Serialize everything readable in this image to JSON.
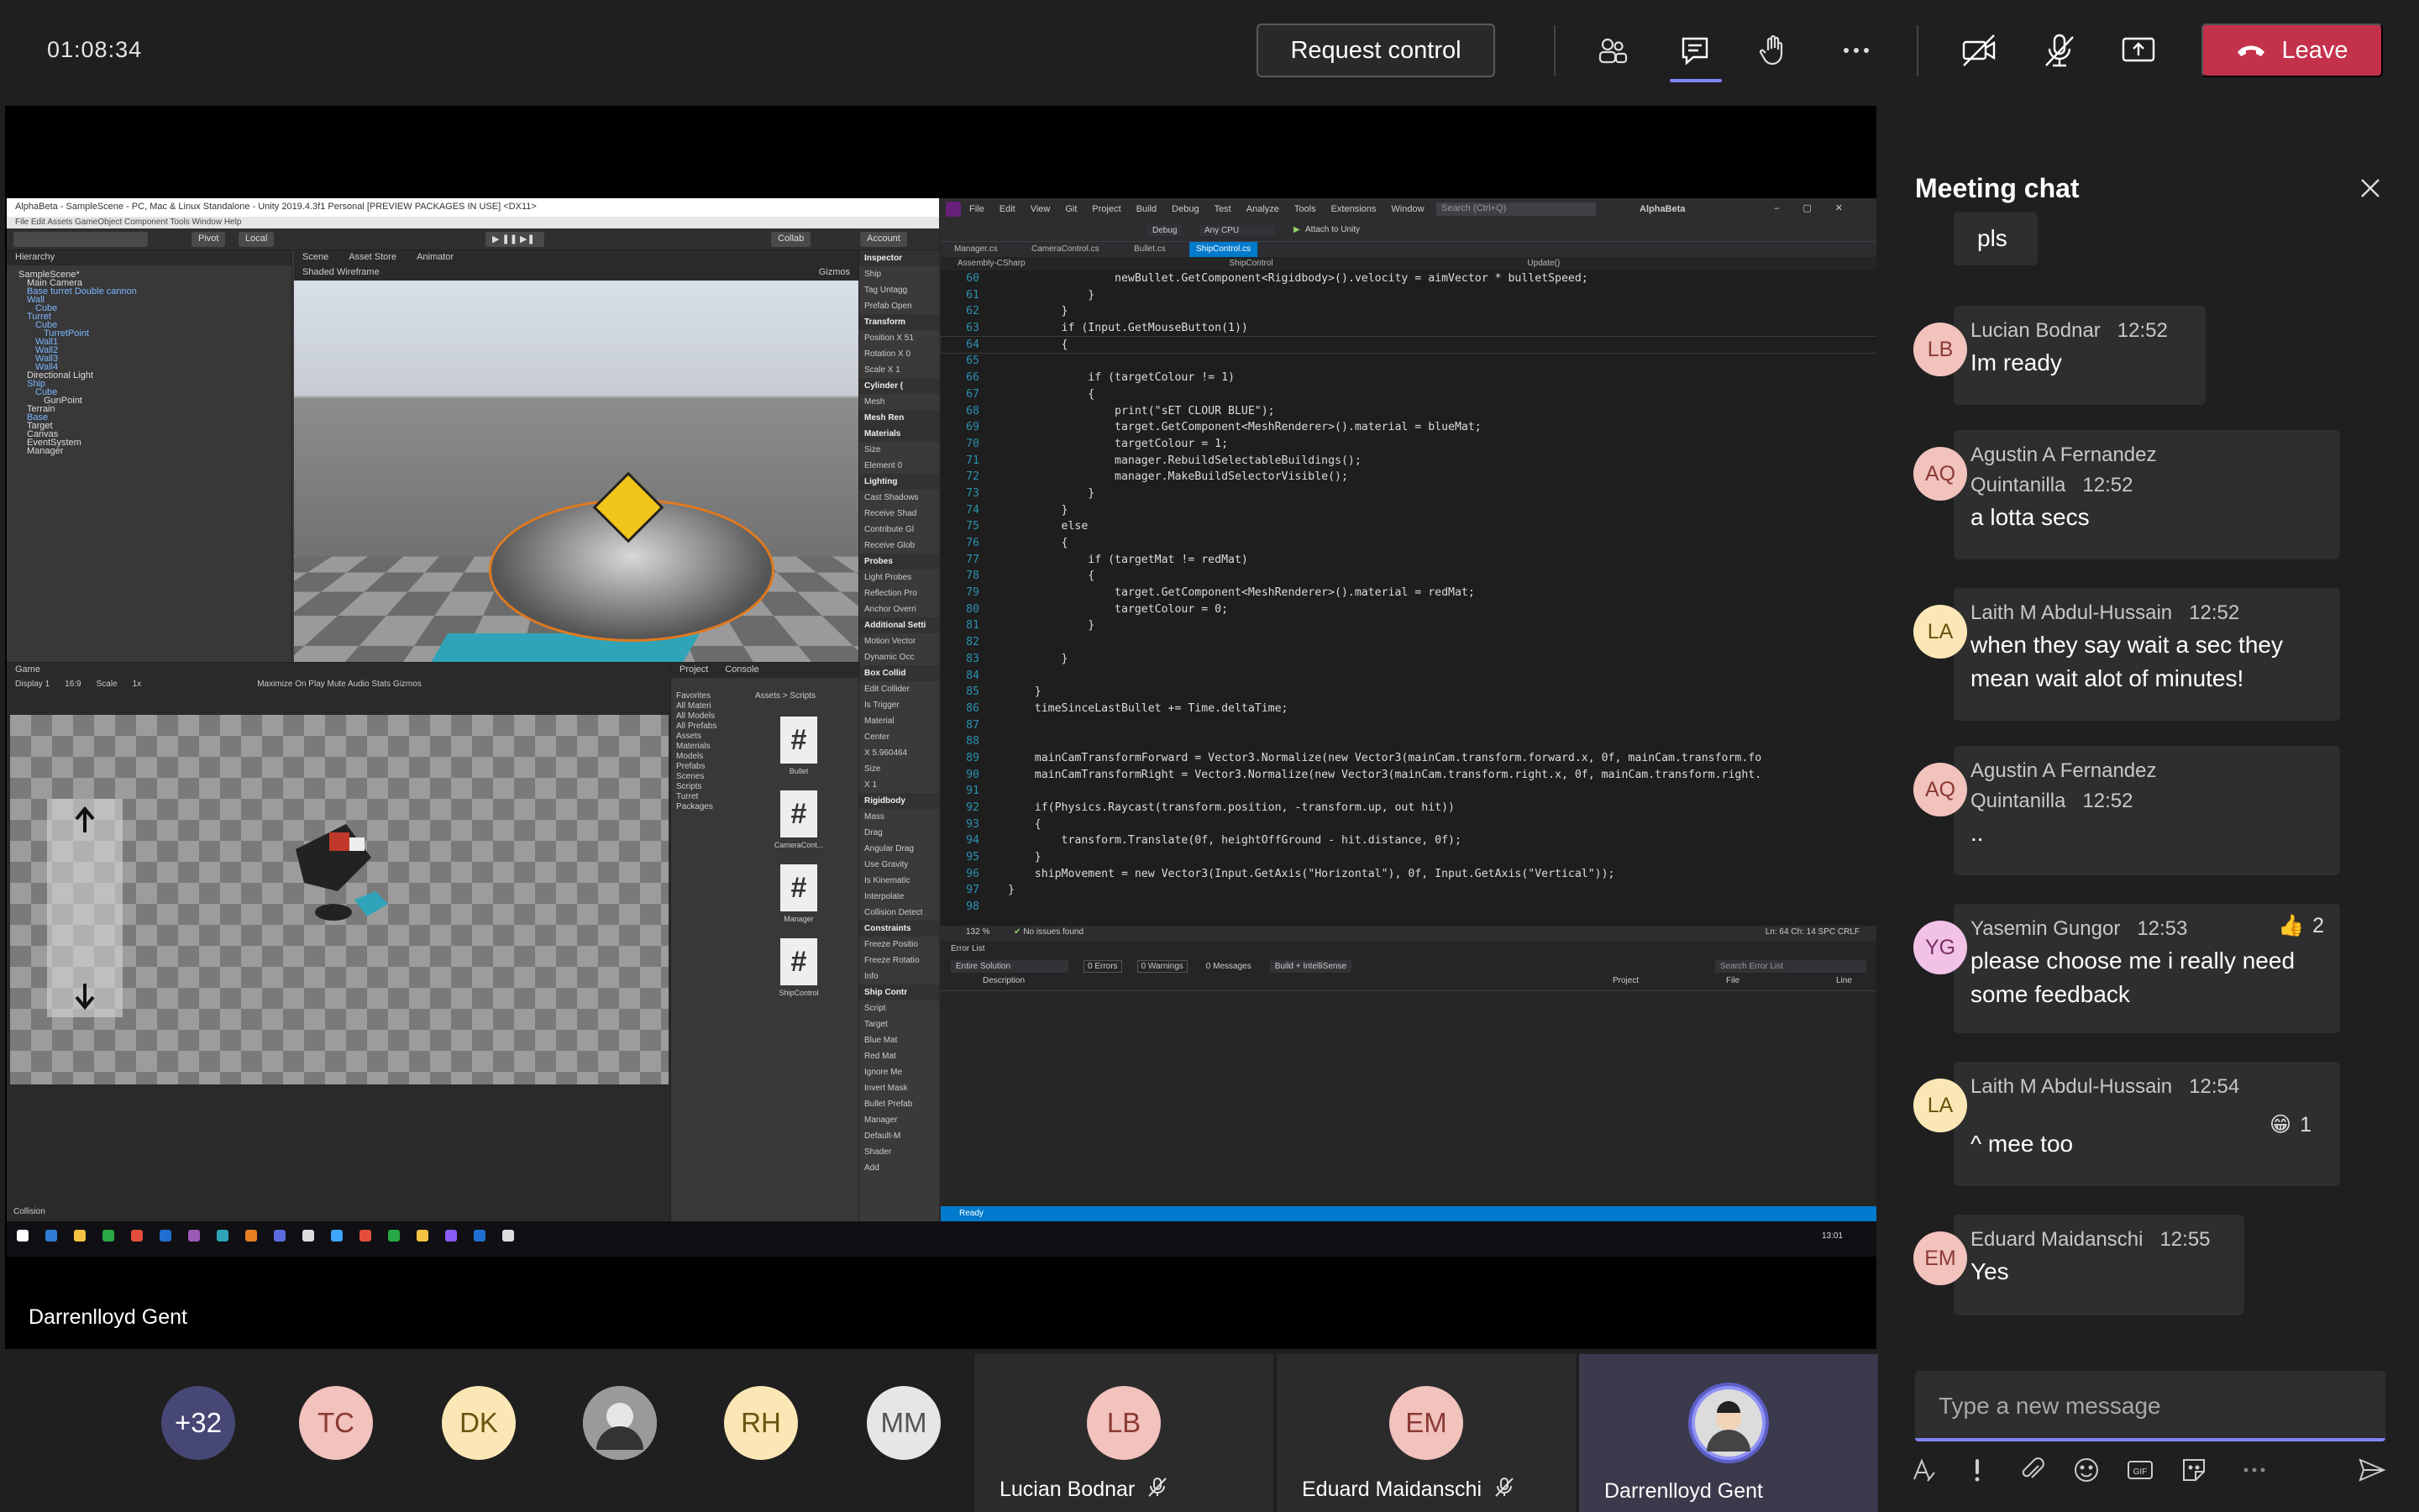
{
  "meeting": {
    "elapsed": "01:08:34",
    "request_control_label": "Request control",
    "leave_label": "Leave",
    "toolbar_icons": [
      "people-icon",
      "chat-icon",
      "raise-hand-icon",
      "more-options-icon",
      "camera-off-icon",
      "mic-off-icon",
      "share-screen-icon"
    ]
  },
  "stage": {
    "presenter_name": "Darrenlloyd Gent"
  },
  "unity": {
    "title": "AlphaBeta - SampleScene - PC, Mac & Linux Standalone - Unity 2019.4.3f1 Personal [PREVIEW PACKAGES IN USE] <DX11>",
    "menu": "File   Edit   Assets   GameObject   Component   Tools   Window   Help",
    "toolbar": {
      "pivot": "Pivot",
      "local": "Local",
      "collab": "Collab",
      "account": "Account",
      "layers": "La"
    },
    "hierarchy_tab": "Hierarchy",
    "hierarchy": [
      {
        "label": "SampleScene*",
        "blue": false,
        "indent": 0
      },
      {
        "label": "Main Camera",
        "blue": false,
        "indent": 1
      },
      {
        "label": "Base turret Double cannon",
        "blue": true,
        "indent": 1
      },
      {
        "label": "Wall",
        "blue": true,
        "indent": 1
      },
      {
        "label": "Cube",
        "blue": true,
        "indent": 2
      },
      {
        "label": "Turret",
        "blue": true,
        "indent": 1
      },
      {
        "label": "Cube",
        "blue": true,
        "indent": 2
      },
      {
        "label": "TurretPoint",
        "blue": true,
        "indent": 3
      },
      {
        "label": "Wall1",
        "blue": true,
        "indent": 2
      },
      {
        "label": "Wall2",
        "blue": true,
        "indent": 2
      },
      {
        "label": "Wall3",
        "blue": true,
        "indent": 2
      },
      {
        "label": "Wall4",
        "blue": true,
        "indent": 2
      },
      {
        "label": "Directional Light",
        "blue": false,
        "indent": 1
      },
      {
        "label": "Ship",
        "blue": true,
        "indent": 1
      },
      {
        "label": "Cube",
        "blue": true,
        "indent": 2
      },
      {
        "label": "GunPoint",
        "blue": false,
        "indent": 3
      },
      {
        "label": "Terrain",
        "blue": false,
        "indent": 1
      },
      {
        "label": "Base",
        "blue": true,
        "indent": 1
      },
      {
        "label": "Target",
        "blue": false,
        "indent": 1
      },
      {
        "label": "Canvas",
        "blue": false,
        "indent": 1
      },
      {
        "label": "EventSystem",
        "blue": false,
        "indent": 1
      },
      {
        "label": "Manager",
        "blue": false,
        "indent": 1
      }
    ],
    "scene_tabs": [
      "Scene",
      "Asset Store",
      "Animator"
    ],
    "scene_shading": "Shaded Wireframe",
    "gizmos_label": "Gizmos",
    "inspector": [
      "Inspector",
      "Ship",
      "Tag  Untagg",
      "Prefab  Open",
      "Transform",
      "Position  X 51",
      "Rotation  X 0",
      "Scale  X 1",
      "Cylinder (",
      "Mesh",
      "Mesh Ren",
      "Materials",
      "Size",
      "Element 0",
      "Lighting",
      "Cast Shadows",
      "Receive Shad",
      "Contribute Gl",
      "Receive Glob",
      "Probes",
      "Light Probes",
      "Reflection Pro",
      "Anchor Overri",
      "Additional Setti",
      "Motion Vector",
      "Dynamic Occ",
      "Box Collid",
      "Edit Collider",
      "Is Trigger",
      "Material",
      "Center",
      "X 5.960464",
      "Size",
      "X 1",
      "Rigidbody",
      "Mass",
      "Drag",
      "Angular Drag",
      "Use Gravity",
      "Is Kinematic",
      "Interpolate",
      "Collision Detect",
      "Constraints",
      "Freeze Positio",
      "Freeze Rotatio",
      "Info",
      "Ship Contr",
      "Script",
      "Target",
      "Blue Mat",
      "Red Mat",
      "Ignore Me",
      "Invert Mask",
      "Bullet Prefab",
      "Manager",
      "Default-M",
      "Shader",
      "Add"
    ],
    "game_tab": "Game",
    "game_bar": {
      "display": "Display 1",
      "aspect": "16:9",
      "scale_label": "Scale",
      "scale_value": "1x",
      "options": "Maximize On Play   Mute Audio   Stats   Gizmos"
    },
    "project_tabs": [
      "Project",
      "Console"
    ],
    "project_tree": [
      "Favorites",
      "All Materi",
      "All Models",
      "All Prefabs",
      "Assets",
      "Materials",
      "Models",
      "Prefabs",
      "Scenes",
      "Scripts",
      "Turret",
      "Packages"
    ],
    "breadcrumb": "Assets > Scripts",
    "scripts": [
      "Bullet",
      "CameraCont...",
      "Manager",
      "ShipControl"
    ],
    "status_text": "Collision"
  },
  "vs": {
    "menu": [
      "File",
      "Edit",
      "View",
      "Git",
      "Project",
      "Build",
      "Debug",
      "Test",
      "Analyze",
      "Tools",
      "Extensions",
      "Window",
      "Help"
    ],
    "search_placeholder": "Search (Ctrl+Q)",
    "solution": "AlphaBeta",
    "config": "Debug",
    "platform": "Any CPU",
    "attach_label": "Attach to Unity",
    "tabs": [
      "Manager.cs",
      "CameraControl.cs",
      "Bullet.cs",
      "ShipControl.cs"
    ],
    "nav": {
      "project": "Assembly-CSharp",
      "class": "ShipControl",
      "method": "Update()"
    },
    "code": [
      {
        "n": "60",
        "t": "                newBullet.GetComponent<Rigidbody>().velocity = aimVector * bulletSpeed;"
      },
      {
        "n": "61",
        "t": "            }"
      },
      {
        "n": "62",
        "t": "        }"
      },
      {
        "n": "63",
        "t": "        if (Input.GetMouseButton(1))"
      },
      {
        "n": "64",
        "t": "        {"
      },
      {
        "n": "65",
        "t": ""
      },
      {
        "n": "66",
        "t": "            if (targetColour != 1)"
      },
      {
        "n": "67",
        "t": "            {"
      },
      {
        "n": "68",
        "t": "                print(\"sET CLOUR BLUE\");"
      },
      {
        "n": "69",
        "t": "                target.GetComponent<MeshRenderer>().material = blueMat;"
      },
      {
        "n": "70",
        "t": "                targetColour = 1;"
      },
      {
        "n": "71",
        "t": "                manager.RebuildSelectableBuildings();"
      },
      {
        "n": "72",
        "t": "                manager.MakeBuildSelectorVisible();"
      },
      {
        "n": "73",
        "t": "            }"
      },
      {
        "n": "74",
        "t": "        }"
      },
      {
        "n": "75",
        "t": "        else"
      },
      {
        "n": "76",
        "t": "        {"
      },
      {
        "n": "77",
        "t": "            if (targetMat != redMat)"
      },
      {
        "n": "78",
        "t": "            {"
      },
      {
        "n": "79",
        "t": "                target.GetComponent<MeshRenderer>().material = redMat;"
      },
      {
        "n": "80",
        "t": "                targetColour = 0;"
      },
      {
        "n": "81",
        "t": "            }"
      },
      {
        "n": "82",
        "t": ""
      },
      {
        "n": "83",
        "t": "        }"
      },
      {
        "n": "84",
        "t": ""
      },
      {
        "n": "85",
        "t": "    }"
      },
      {
        "n": "86",
        "t": "    timeSinceLastBullet += Time.deltaTime;"
      },
      {
        "n": "87",
        "t": ""
      },
      {
        "n": "88",
        "t": ""
      },
      {
        "n": "89",
        "t": "    mainCamTransformForward = Vector3.Normalize(new Vector3(mainCam.transform.forward.x, 0f, mainCam.transform.fo"
      },
      {
        "n": "90",
        "t": "    mainCamTransformRight = Vector3.Normalize(new Vector3(mainCam.transform.right.x, 0f, mainCam.transform.right."
      },
      {
        "n": "91",
        "t": ""
      },
      {
        "n": "92",
        "t": "    if(Physics.Raycast(transform.position, -transform.up, out hit))"
      },
      {
        "n": "93",
        "t": "    {"
      },
      {
        "n": "94",
        "t": "        transform.Translate(0f, heightOffGround - hit.distance, 0f);"
      },
      {
        "n": "95",
        "t": "    }"
      },
      {
        "n": "96",
        "t": "    shipMovement = new Vector3(Input.GetAxis(\"Horizontal\"), 0f, Input.GetAxis(\"Vertical\"));"
      },
      {
        "n": "97",
        "t": "}"
      },
      {
        "n": "98",
        "t": ""
      }
    ],
    "status": {
      "zoom": "132 %",
      "issues": "No issues found",
      "position": "Ln: 64   Ch: 14   SPC   CRLF"
    },
    "error_list": {
      "title": "Error List",
      "scope": "Entire Solution",
      "errors": "0 Errors",
      "warnings": "0 Warnings",
      "messages": "0 Messages",
      "build": "Build + IntelliSense",
      "search": "Search Error List",
      "columns": [
        "Description",
        "Project",
        "File",
        "Line"
      ]
    },
    "ready": "Ready",
    "clock": "13:01"
  },
  "participants": {
    "overflow": "+32",
    "avatars": [
      {
        "initials": "TC",
        "bg": "#f2c2bd",
        "fg": "#8a3a33"
      },
      {
        "initials": "DK",
        "bg": "#fbe7b5",
        "fg": "#6b5410"
      },
      {
        "initials": "",
        "bg": "#b9b9b9",
        "fg": "#333"
      },
      {
        "initials": "RH",
        "bg": "#fbe7b5",
        "fg": "#6b5410"
      },
      {
        "initials": "MM",
        "bg": "#e6e6e6",
        "fg": "#555"
      }
    ],
    "tiles": [
      {
        "initials": "LB",
        "name": "Lucian Bodnar",
        "bg": "#f2c2bd",
        "fg": "#8a3a33"
      },
      {
        "initials": "EM",
        "name": "Eduard Maidanschi",
        "bg": "#f2c2bd",
        "fg": "#8a3a33"
      },
      {
        "initials": "",
        "name": "Darrenlloyd Gent",
        "bg": "#d0d0d0",
        "fg": "#333"
      }
    ]
  },
  "chat": {
    "title": "Meeting chat",
    "compose_placeholder": "Type a new message",
    "messages": [
      {
        "initials": "",
        "author": "",
        "time": "",
        "text": "pls",
        "status": ""
      },
      {
        "initials": "LB",
        "author": "Lucian Bodnar",
        "time": "12:52",
        "text": "Im ready",
        "status": "away"
      },
      {
        "initials": "AQ",
        "author": "Agustin A Fernandez Quintanilla",
        "time": "12:52",
        "text": "a lotta secs",
        "status": "busy"
      },
      {
        "initials": "LA",
        "author": "Laith M Abdul-Hussain",
        "time": "12:52",
        "text": "when they say wait a sec they mean wait alot of minutes!",
        "status": "dnd"
      },
      {
        "initials": "AQ",
        "author": "Agustin A Fernandez Quintanilla",
        "time": "12:52",
        "text": "..",
        "status": "busy"
      },
      {
        "initials": "YG",
        "author": "Yasemin Gungor",
        "time": "12:53",
        "text": "please choose me i really need some feedback",
        "status": "busy"
      },
      {
        "initials": "LA",
        "author": "Laith M Abdul-Hussain",
        "time": "12:54",
        "text": "^ mee too",
        "status": "dnd"
      },
      {
        "initials": "EM",
        "author": "Eduard Maidanschi",
        "time": "12:55",
        "text": "Yes",
        "status": "busy"
      }
    ],
    "reactions": [
      {
        "emoji": "👍",
        "count": "2"
      },
      {
        "emoji": "😁",
        "count": "1"
      }
    ],
    "avatar_colors": {
      "LB": {
        "bg": "#f2c2bd",
        "fg": "#8a3a33"
      },
      "AQ": {
        "bg": "#f2c2bd",
        "fg": "#8a3a33"
      },
      "LA": {
        "bg": "#fbe7b5",
        "fg": "#6b5410"
      },
      "YG": {
        "bg": "#f2c2e6",
        "fg": "#7a2f66"
      },
      "EM": {
        "bg": "#f2c2bd",
        "fg": "#8a3a33"
      }
    }
  },
  "colors": {
    "accent": "#7f85f5",
    "leave": "#c4314b",
    "vs_blue": "#007acc"
  }
}
